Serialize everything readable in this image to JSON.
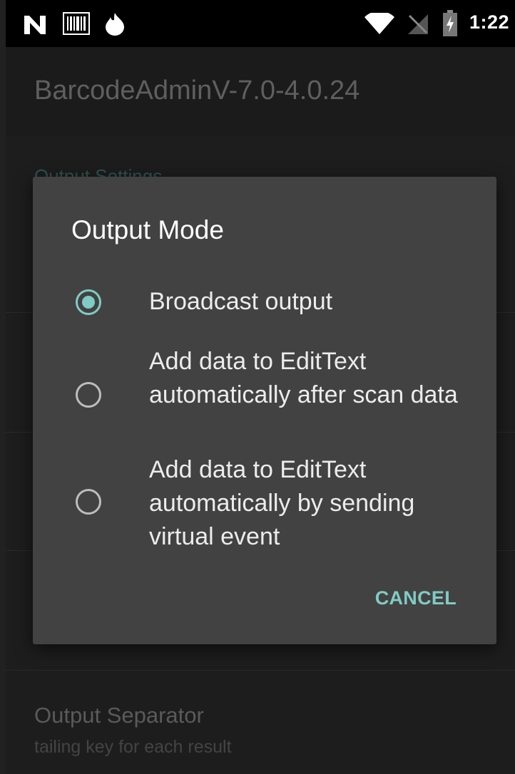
{
  "status_bar": {
    "time": "1:22",
    "icons": [
      "n-notification-icon",
      "barcode-icon",
      "fire-icon",
      "wifi-icon",
      "no-sim-icon",
      "battery-charging-icon"
    ]
  },
  "app_bar": {
    "title": "BarcodeAdminV-7.0-4.0.24"
  },
  "background_list": {
    "header": "Output Settings",
    "items": [
      {
        "title": "Output Separator",
        "subtitle": "tailing key for each result"
      }
    ]
  },
  "dialog": {
    "title": "Output Mode",
    "options": [
      {
        "label": "Broadcast output",
        "selected": true
      },
      {
        "label": "Add data to EditText automatically after scan data",
        "selected": false
      },
      {
        "label": "Add data to EditText automatically by sending virtual event",
        "selected": false
      }
    ],
    "cancel_label": "CANCEL"
  },
  "colors": {
    "accent": "#80cbc4",
    "dialog_bg": "#424242",
    "screen_bg": "#212121"
  }
}
